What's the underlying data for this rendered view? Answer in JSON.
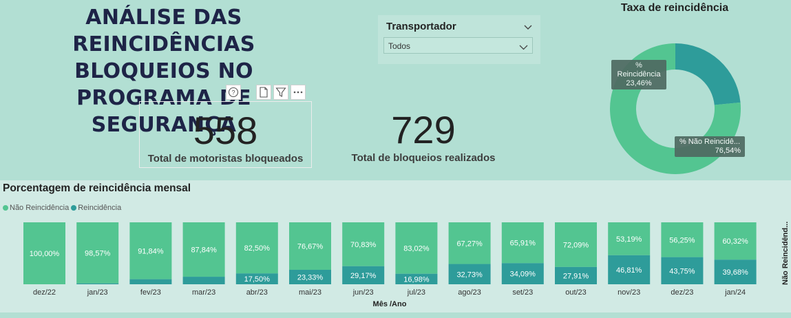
{
  "header": {
    "title_line1": "ANÁLISE DAS REINCIDÊNCIAS",
    "title_line2": "BLOQUEIOS NO PROGRAMA DE",
    "title_line3": "SEGURANÇA"
  },
  "slicer": {
    "label": "Transportador",
    "selected": "Todos"
  },
  "cards": [
    {
      "value": "558",
      "label": "Total de motoristas bloqueados"
    },
    {
      "value": "729",
      "label": "Total de bloqueios realizados"
    }
  ],
  "donut": {
    "title": "Taxa de reincidência",
    "slices": [
      {
        "name": "% Reincidência",
        "value": 23.46,
        "label": "23,46%",
        "color": "#2e9c9a"
      },
      {
        "name": "% Não Reincidê...",
        "value": 76.54,
        "label": "76,54%",
        "color": "#53c591"
      }
    ]
  },
  "chart_title": "Porcentagem de reincidência mensal",
  "chart_data": {
    "type": "bar",
    "stacked": "100%",
    "categories": [
      "dez/22",
      "jan/23",
      "fev/23",
      "mar/23",
      "abr/23",
      "mai/23",
      "jun/23",
      "jul/23",
      "ago/23",
      "set/23",
      "out/23",
      "nov/23",
      "dez/23",
      "jan/24"
    ],
    "series": [
      {
        "name": "Não Reincidência",
        "color": "#53c591",
        "values": [
          100.0,
          98.57,
          91.84,
          87.84,
          82.5,
          76.67,
          70.83,
          83.02,
          67.27,
          65.91,
          72.09,
          53.19,
          56.25,
          60.32
        ],
        "labels": [
          "100,00%",
          "98,57%",
          "91,84%",
          "87,84%",
          "82,50%",
          "76,67%",
          "70,83%",
          "83,02%",
          "67,27%",
          "65,91%",
          "72,09%",
          "53,19%",
          "56,25%",
          "60,32%"
        ]
      },
      {
        "name": "Reincidência",
        "color": "#2e9c9a",
        "values": [
          0.0,
          1.43,
          8.16,
          12.16,
          17.5,
          23.33,
          29.17,
          16.98,
          32.73,
          34.09,
          27.91,
          46.81,
          43.75,
          39.68
        ],
        "labels": [
          "",
          "",
          "",
          "",
          "17,50%",
          "23,33%",
          "29,17%",
          "16,98%",
          "32,73%",
          "34,09%",
          "27,91%",
          "46,81%",
          "43,75%",
          "39,68%"
        ]
      }
    ],
    "xlabel": "Mês /Ano",
    "ylim": [
      0,
      100
    ],
    "legend_position": "top-left",
    "side_label": "Não Reincidênd..."
  }
}
